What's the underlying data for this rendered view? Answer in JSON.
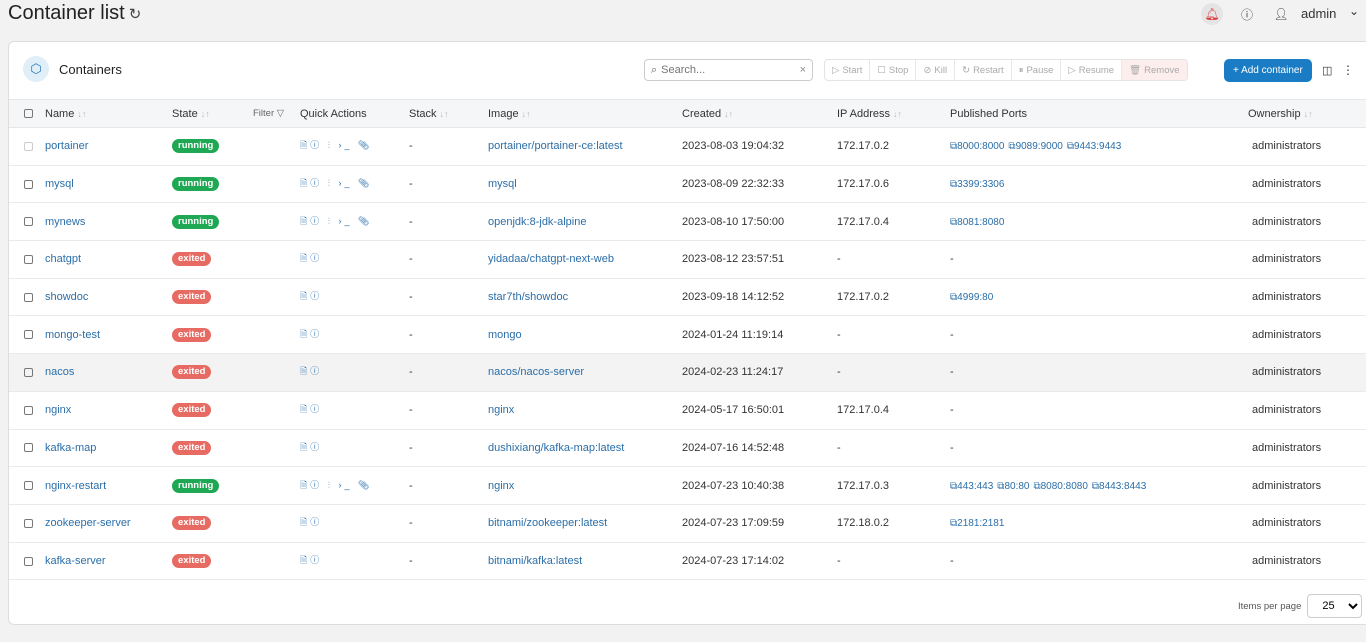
{
  "header": {
    "title": "Container list",
    "user": "admin"
  },
  "card": {
    "title": "Containers",
    "search_placeholder": "Search...",
    "actions": [
      "Start",
      "Stop",
      "Kill",
      "Restart",
      "Pause",
      "Resume",
      "Remove"
    ],
    "add_label": "+ Add container"
  },
  "columns": {
    "name": "Name",
    "state": "State",
    "filter": "Filter",
    "quick": "Quick Actions",
    "stack": "Stack",
    "image": "Image",
    "created": "Created",
    "ip": "IP Address",
    "ports": "Published Ports",
    "owner": "Ownership"
  },
  "rows": [
    {
      "name": "portainer",
      "state": "running",
      "stack": "-",
      "image": "portainer/portainer-ce:latest",
      "created": "2023-08-03 19:04:32",
      "ip": "172.17.0.2",
      "ports": [
        "8000:8000",
        "9089:9000",
        "9443:9443"
      ],
      "owner": "administrators"
    },
    {
      "name": "mysql",
      "state": "running",
      "stack": "-",
      "image": "mysql",
      "created": "2023-08-09 22:32:33",
      "ip": "172.17.0.6",
      "ports": [
        "3399:3306"
      ],
      "owner": "administrators"
    },
    {
      "name": "mynews",
      "state": "running",
      "stack": "-",
      "image": "openjdk:8-jdk-alpine",
      "created": "2023-08-10 17:50:00",
      "ip": "172.17.0.4",
      "ports": [
        "8081:8080"
      ],
      "owner": "administrators"
    },
    {
      "name": "chatgpt",
      "state": "exited",
      "stack": "-",
      "image": "yidadaa/chatgpt-next-web",
      "created": "2023-08-12 23:57:51",
      "ip": "-",
      "ports": [],
      "owner": "administrators"
    },
    {
      "name": "showdoc",
      "state": "exited",
      "stack": "-",
      "image": "star7th/showdoc",
      "created": "2023-09-18 14:12:52",
      "ip": "172.17.0.2",
      "ports": [
        "4999:80"
      ],
      "owner": "administrators"
    },
    {
      "name": "mongo-test",
      "state": "exited",
      "stack": "-",
      "image": "mongo",
      "created": "2024-01-24 11:19:14",
      "ip": "-",
      "ports": [],
      "owner": "administrators"
    },
    {
      "name": "nacos",
      "state": "exited",
      "stack": "-",
      "image": "nacos/nacos-server",
      "created": "2024-02-23 11:24:17",
      "ip": "-",
      "ports": [],
      "owner": "administrators"
    },
    {
      "name": "nginx",
      "state": "exited",
      "stack": "-",
      "image": "nginx",
      "created": "2024-05-17 16:50:01",
      "ip": "172.17.0.4",
      "ports": [],
      "owner": "administrators"
    },
    {
      "name": "kafka-map",
      "state": "exited",
      "stack": "-",
      "image": "dushixiang/kafka-map:latest",
      "created": "2024-07-16 14:52:48",
      "ip": "-",
      "ports": [],
      "owner": "administrators"
    },
    {
      "name": "nginx-restart",
      "state": "running",
      "stack": "-",
      "image": "nginx",
      "created": "2024-07-23 10:40:38",
      "ip": "172.17.0.3",
      "ports": [
        "443:443",
        "80:80",
        "8080:8080",
        "8443:8443"
      ],
      "owner": "administrators"
    },
    {
      "name": "zookeeper-server",
      "state": "exited",
      "stack": "-",
      "image": "bitnami/zookeeper:latest",
      "created": "2024-07-23 17:09:59",
      "ip": "172.18.0.2",
      "ports": [
        "2181:2181"
      ],
      "owner": "administrators"
    },
    {
      "name": "kafka-server",
      "state": "exited",
      "stack": "-",
      "image": "bitnami/kafka:latest",
      "created": "2024-07-23 17:14:02",
      "ip": "-",
      "ports": [],
      "owner": "administrators"
    }
  ],
  "footer": {
    "items_label": "Items per page",
    "items_value": "25"
  },
  "colors": {
    "accent": "#1a7cc4",
    "running": "#1ea854",
    "exited": "#e76a63"
  }
}
